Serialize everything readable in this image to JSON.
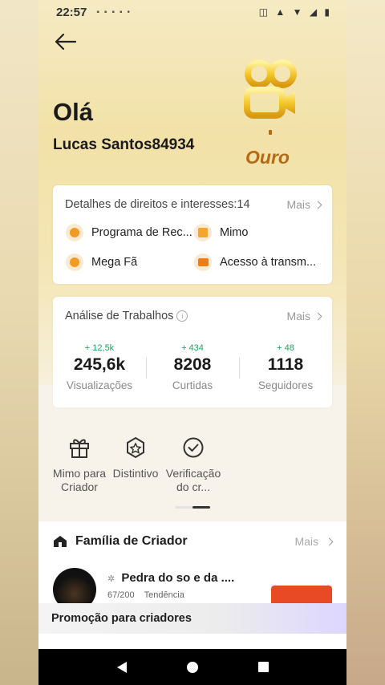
{
  "status_bar": {
    "time": "22:57",
    "notification_icons": [
      "app-notification-icon",
      "app-notification-icon",
      "app-notification-icon",
      "app-notification-icon"
    ],
    "right_icons": [
      "vibrate-icon",
      "volte-icon",
      "wifi-icon",
      "signal-icon",
      "battery-icon"
    ]
  },
  "header": {
    "greeting": "Olá",
    "username": "Lucas Santos84934",
    "tier_label": "Ouro",
    "accent_color": "#b36a12"
  },
  "rights_card": {
    "title": "Detalhes de direitos e interesses:14",
    "more_label": "Mais",
    "items": [
      {
        "label": "Programa de Rec...",
        "icon": "coin-icon"
      },
      {
        "label": "Mimo",
        "icon": "gift-box-icon"
      },
      {
        "label": "Mega Fã",
        "icon": "fan-icon"
      },
      {
        "label": "Acesso à transm...",
        "icon": "live-camera-icon"
      }
    ]
  },
  "stats_card": {
    "title": "Análise de Trabalhos",
    "more_label": "Mais",
    "stats": [
      {
        "delta": "+ 12,5k",
        "value": "245,6k",
        "label": "Visualizações"
      },
      {
        "delta": "+ 434",
        "value": "8208",
        "label": "Curtidas"
      },
      {
        "delta": "+ 48",
        "value": "1118",
        "label": "Seguidores"
      }
    ],
    "delta_color": "#22a35a"
  },
  "tools": [
    {
      "label": "Mimo para Criador",
      "icon": "gift-icon"
    },
    {
      "label": "Distintivo",
      "icon": "badge-icon"
    },
    {
      "label": "Verificação do cr...",
      "icon": "verified-check-icon"
    }
  ],
  "family": {
    "title": "Família de Criador",
    "more_label": "Mais",
    "group_name": "Pedra do so  e da  ....",
    "members": "67/200",
    "tag": "Tendência"
  },
  "promo": {
    "label": "Promoção para criadores"
  }
}
